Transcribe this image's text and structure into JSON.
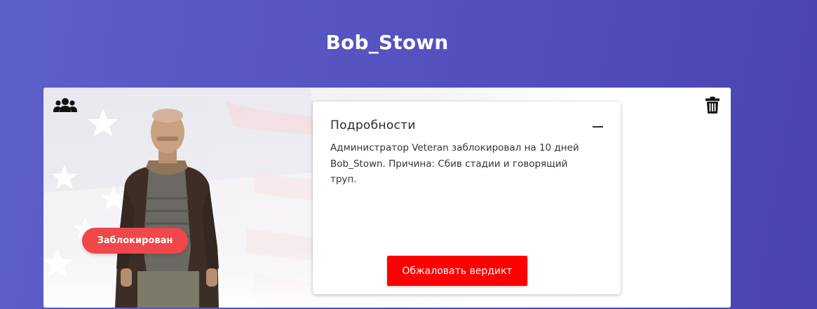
{
  "profile": {
    "name": "Bob_Stown",
    "status": "Заблокирован"
  },
  "details": {
    "title": "Подробности",
    "text": "Администратор Veteran заблокировал на 10 дней Bob_Stown. Причина: Сбив стадии и говорящий труп.",
    "appeal_label": "Обжаловать вердикт"
  },
  "icons": {
    "group": "users-icon",
    "delete": "trash-icon",
    "collapse": "minus-icon"
  },
  "colors": {
    "background": "#5553c0",
    "status_badge": "#f0474a",
    "appeal_button": "#ff0000"
  }
}
